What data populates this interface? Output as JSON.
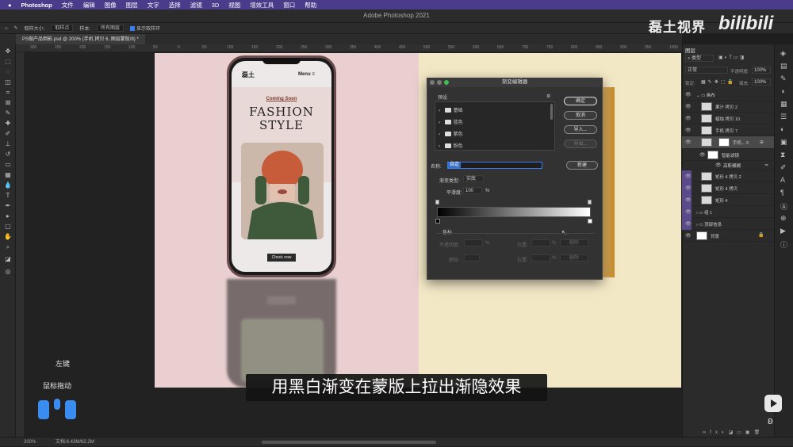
{
  "menubar": {
    "app": "Photoshop",
    "items": [
      "文件",
      "编辑",
      "图像",
      "图层",
      "文字",
      "选择",
      "滤镜",
      "3D",
      "视图",
      "增效工具",
      "窗口",
      "帮助"
    ]
  },
  "window_title": "Adobe Photoshop 2021",
  "options": {
    "sample_size_label": "取样大小:",
    "sample_size_value": "取样点",
    "sample_label": "样本:",
    "sample_value": "所有图层",
    "show_ring_label": "显示取样环"
  },
  "doc_tab": "PS做产品倒影.psd @ 200% (手机 拷贝 6, 图层蒙版/8) *",
  "ruler_labels": [
    "300",
    "250",
    "200",
    "150",
    "100",
    "50",
    "0",
    "50",
    "100",
    "150",
    "200",
    "250",
    "300",
    "350",
    "400",
    "450",
    "500",
    "550",
    "600",
    "650",
    "700",
    "750",
    "800",
    "850",
    "900",
    "950",
    "1000"
  ],
  "phone": {
    "brand": "磊土",
    "menu": "Menu ≡",
    "coming_soon": "Coming Soon",
    "headline_1": "FASHION",
    "headline_2": "STYLE",
    "cta": "Check now"
  },
  "dialog": {
    "title": "渐变编辑器",
    "presets_label": "预设",
    "presets": [
      "基础",
      "蓝色",
      "紫色",
      "粉色"
    ],
    "ok": "确定",
    "cancel": "取消",
    "import": "导入...",
    "export": "导出...",
    "name_label": "名称:",
    "name_value": "自定",
    "new": "新建",
    "gradient_type_label": "渐变类型:",
    "gradient_type_value": "实底",
    "smoothness_label": "平滑度:",
    "smoothness_value": "100",
    "percent": "%",
    "stops_label": "色标",
    "opacity_label": "不透明度:",
    "location_label": "位置:",
    "color_label": "颜色:",
    "delete": "删除"
  },
  "layers_panel": {
    "title": "图层",
    "kind_label": "类型",
    "blend_mode": "正常",
    "opacity_label": "不透明度:",
    "opacity_value": "100%",
    "lock_label": "锁定:",
    "fill_label": "填充:",
    "fill_value": "100%",
    "layers": [
      {
        "name": "画布"
      },
      {
        "name": "果汁 拷贝 2"
      },
      {
        "name": "蜡烛 拷贝 10"
      },
      {
        "name": "手机 拷贝 7"
      },
      {
        "name": "手机... 6"
      },
      {
        "name": "智能滤镜"
      },
      {
        "name": "高斯模糊"
      },
      {
        "name": "矩形 4 拷贝 2"
      },
      {
        "name": "矩形 4 拷贝"
      },
      {
        "name": "矩形 4"
      },
      {
        "name": "组 1"
      },
      {
        "name": "顶部信息"
      },
      {
        "name": "背景"
      }
    ]
  },
  "status": {
    "zoom": "200%",
    "doc": "文档:6.43M/82.2M"
  },
  "overlay": {
    "subtitle": "用黑白渐变在蒙版上拉出渐隐效果",
    "key_left": "左键",
    "key_drag": "鼠标拖动",
    "watermark": "磊土视界",
    "bilibili": "bilibili"
  }
}
